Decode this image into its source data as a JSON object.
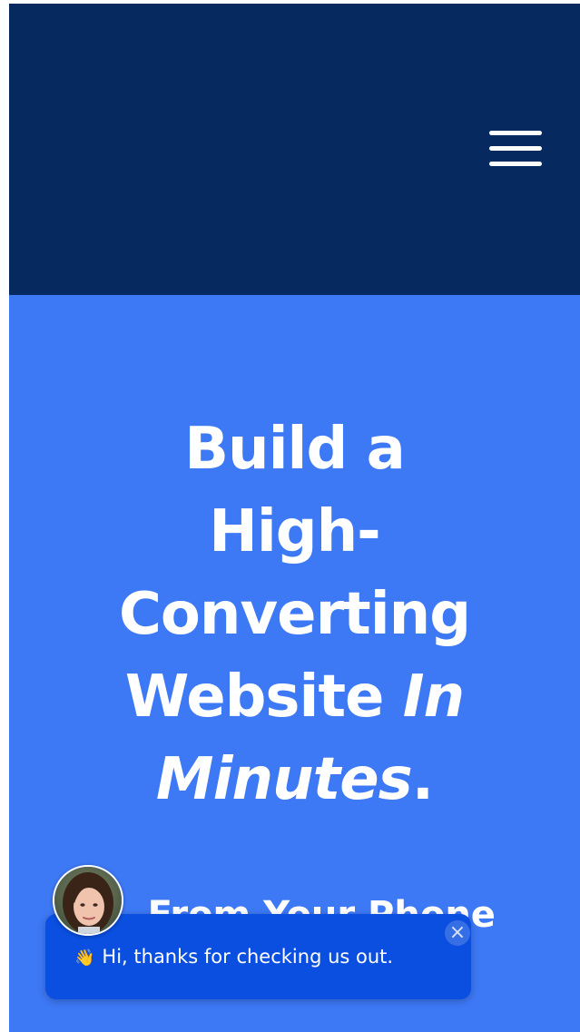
{
  "header": {
    "menu_icon": "hamburger-menu-icon"
  },
  "hero": {
    "headline_lines": [
      "Build a",
      "High-",
      "Converting",
      "Website"
    ],
    "headline_italic_1": "In",
    "headline_italic_2": "Minutes",
    "headline_period": ".",
    "subline": "... From Your Phone",
    "subline_2": ""
  },
  "chat": {
    "wave_icon": "waving-hand-icon",
    "wave_glyph": "👋",
    "message": "Hi, thanks for checking us out.",
    "close_glyph": "×"
  },
  "colors": {
    "header_bg": "#062a5f",
    "hero_bg": "#3d78f5",
    "chat_bg": "#0a4fe0",
    "text": "#ffffff"
  }
}
